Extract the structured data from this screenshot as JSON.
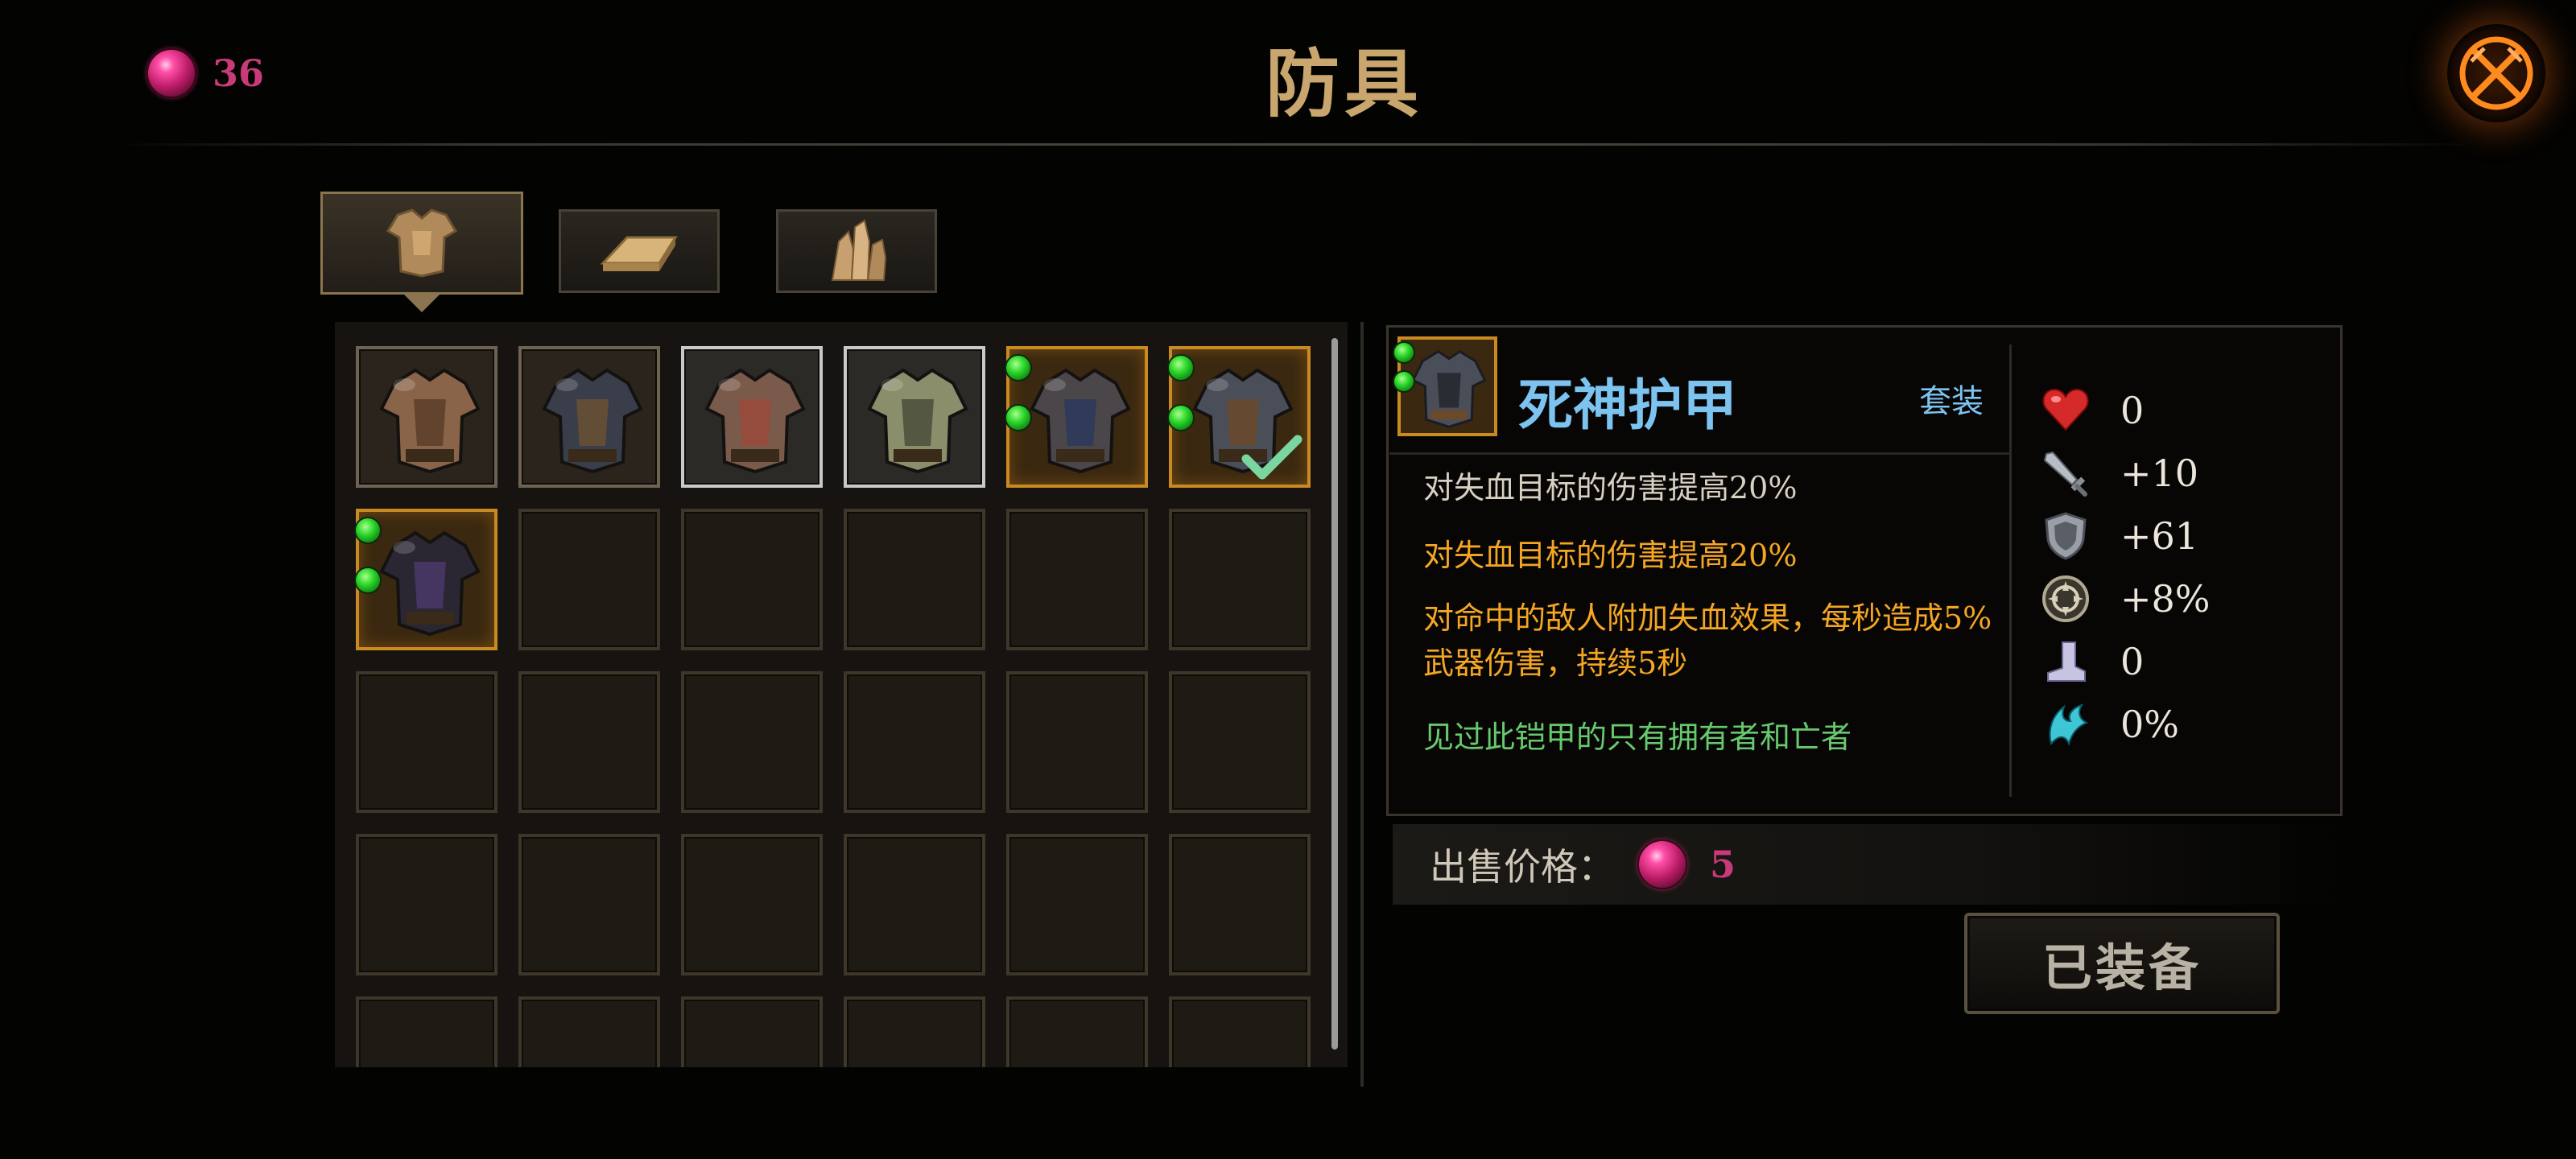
{
  "header": {
    "currency": {
      "icon": "red-gem-icon",
      "count": "36",
      "color": "#c93b78"
    },
    "title": "防具",
    "close_icon": "crossed-swords-close-icon"
  },
  "tabs": [
    {
      "id": "armor",
      "icon": "chest-armor-icon",
      "selected": true
    },
    {
      "id": "materials",
      "icon": "gold-ingot-icon",
      "selected": false
    },
    {
      "id": "crystals",
      "icon": "crystal-cluster-icon",
      "selected": false
    }
  ],
  "inventory": {
    "slots": [
      {
        "icon": "leather-chest-armor-icon",
        "frame": "plain",
        "sockets": 0,
        "equipped": false
      },
      {
        "icon": "dark-plate-armor-icon",
        "frame": "plain",
        "sockets": 0,
        "equipped": false
      },
      {
        "icon": "bronze-plate-armor-icon",
        "frame": "silver",
        "sockets": 0,
        "equipped": false
      },
      {
        "icon": "olive-plate-armor-icon",
        "frame": "silver",
        "sockets": 0,
        "equipped": false
      },
      {
        "icon": "spiked-plate-armor-icon",
        "frame": "gold",
        "sockets": 2,
        "equipped": false
      },
      {
        "icon": "reaper-armor-icon",
        "frame": "gold",
        "sockets": 2,
        "equipped": true
      },
      {
        "icon": "shadow-plate-armor-icon",
        "frame": "gold",
        "sockets": 2,
        "equipped": false
      }
    ],
    "colors": {
      "plain": "#6e6250",
      "silver": "#c9c9c9",
      "gold": "#c98a22",
      "socket": "#2ad62a"
    }
  },
  "detail": {
    "name": "死神护甲",
    "set_label": "套装",
    "name_color": "#7cc3f0",
    "effects": [
      {
        "text": "对失血目标的伤害提高20%",
        "color": "#d8d0c2"
      },
      {
        "text": "对失血目标的伤害提高20%",
        "color": "#f5a623"
      },
      {
        "text": "对命中的敌人附加失血效果，每秒造成5%武器伤害，持续5秒",
        "color": "#f5a623"
      }
    ],
    "flavor": "见过此铠甲的只有拥有者和亡者",
    "stats": [
      {
        "icon": "heart-icon",
        "value": "0"
      },
      {
        "icon": "sword-icon",
        "value": "+10"
      },
      {
        "icon": "shield-icon",
        "value": "+61"
      },
      {
        "icon": "crit-emblem-icon",
        "value": "+8%"
      },
      {
        "icon": "boot-icon",
        "value": "0"
      },
      {
        "icon": "dodge-wing-icon",
        "value": "0%"
      }
    ],
    "sell": {
      "label": "出售价格：",
      "price": "5"
    },
    "equip_button": "已装备"
  }
}
